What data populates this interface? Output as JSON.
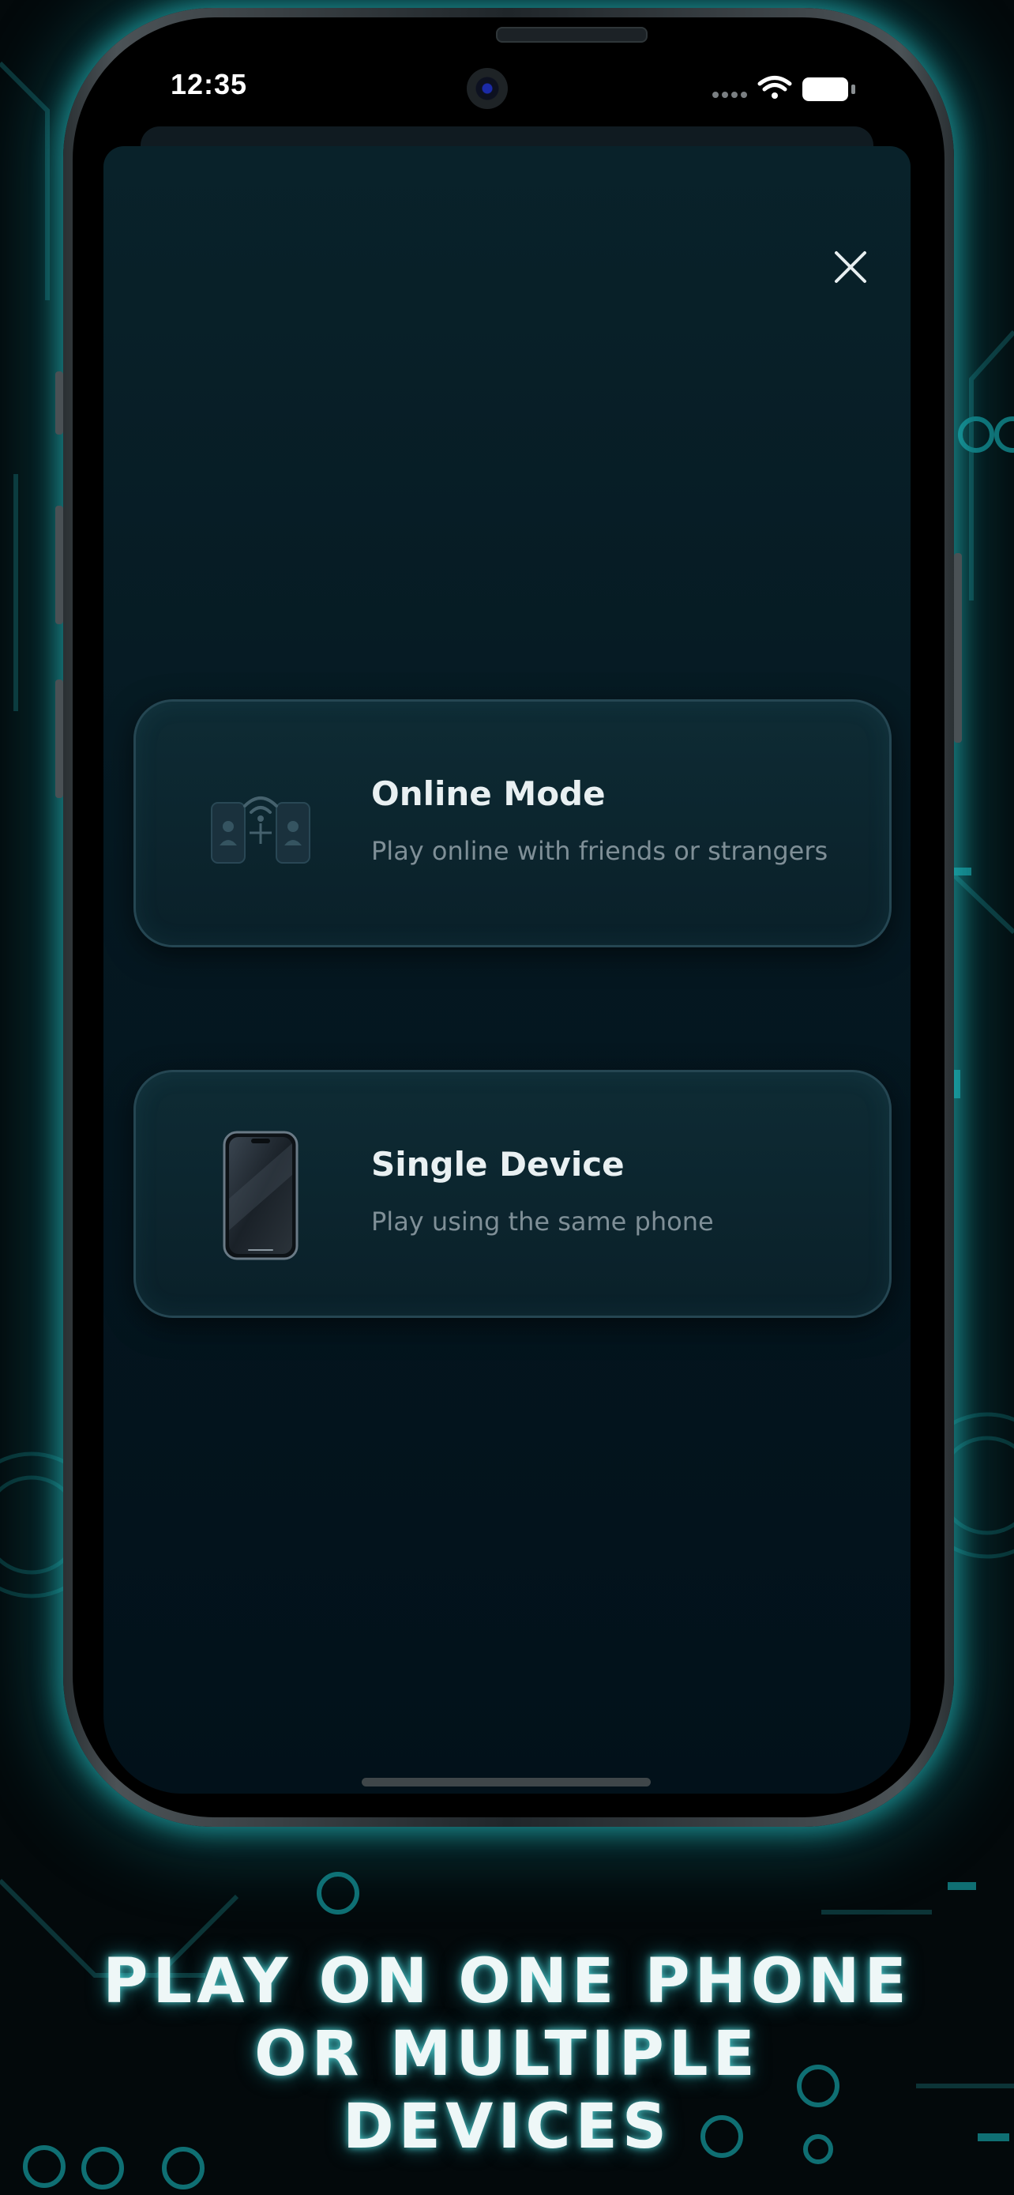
{
  "status_bar": {
    "time": "12:35",
    "icons": [
      "cellular-dots-icon",
      "wifi-icon",
      "battery-icon"
    ]
  },
  "sheet": {
    "close_icon": "close-icon"
  },
  "modes": [
    {
      "title": "Online Mode",
      "subtitle": "Play online with friends or strangers",
      "icon": "two-phones-wifi-icon"
    },
    {
      "title": "Single Device",
      "subtitle": "Play using the same phone",
      "icon": "smartphone-icon"
    }
  ],
  "caption": {
    "line1": "PLAY ON ONE PHONE",
    "line2": "OR MULTIPLE",
    "line3": "DEVICES"
  },
  "colors": {
    "background": "#03090b",
    "glow": "#2fc8c8",
    "sheet": "#051821",
    "card_border": "#254652"
  }
}
